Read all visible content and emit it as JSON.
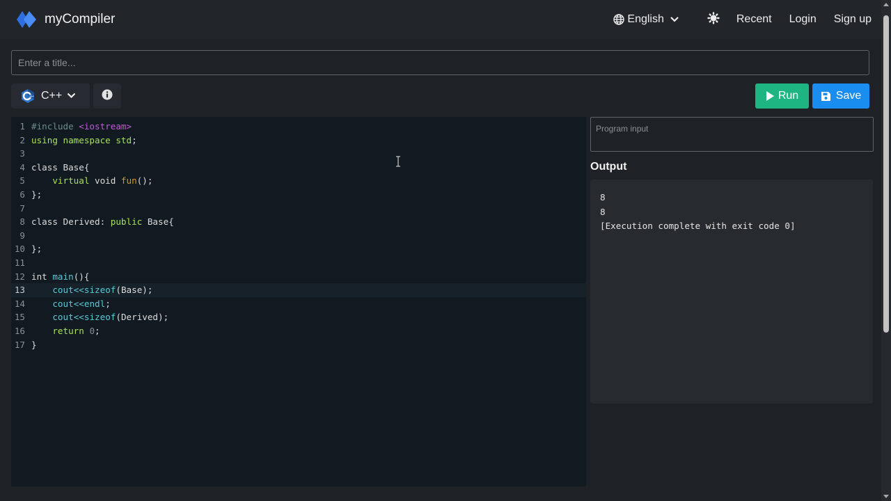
{
  "navbar": {
    "brand": "myCompiler",
    "language": "English",
    "links": [
      "Recent",
      "Login",
      "Sign up"
    ],
    "colors": {
      "brand_logo": "#3b82f6"
    }
  },
  "editor_title": {
    "placeholder": "Enter a title..."
  },
  "toolbar": {
    "language": "C++",
    "run_label": "Run",
    "save_label": "Save",
    "colors": {
      "run": "#1fb583",
      "save": "#1a8ef0"
    }
  },
  "editor": {
    "active_line": 13,
    "lines": [
      [
        [
          "#include ",
          "pre"
        ],
        [
          "<iostream>",
          "inc"
        ]
      ],
      [
        [
          "using namespace std",
          "kw"
        ],
        [
          ";",
          ""
        ]
      ],
      [],
      [
        [
          "class Base{",
          ""
        ]
      ],
      [
        [
          "    ",
          ""
        ],
        [
          "virtual",
          "kw"
        ],
        [
          " void ",
          ""
        ],
        [
          "fun",
          "fn"
        ],
        [
          "();",
          ""
        ]
      ],
      [
        [
          "};",
          ""
        ]
      ],
      [],
      [
        [
          "class Derived: ",
          ""
        ],
        [
          "public",
          "kw"
        ],
        [
          " Base{",
          ""
        ]
      ],
      [],
      [
        [
          "};",
          ""
        ]
      ],
      [],
      [
        [
          "int ",
          ""
        ],
        [
          "main",
          "cout"
        ],
        [
          "(){",
          ""
        ]
      ],
      [
        [
          "    ",
          ""
        ],
        [
          "cout",
          "cout"
        ],
        [
          "<<",
          "tok"
        ],
        [
          "sizeof",
          "cout"
        ],
        [
          "(Base);",
          ""
        ]
      ],
      [
        [
          "    ",
          ""
        ],
        [
          "cout",
          "cout"
        ],
        [
          "<<",
          "tok"
        ],
        [
          "endl",
          "cout"
        ],
        [
          ";",
          ""
        ]
      ],
      [
        [
          "    ",
          ""
        ],
        [
          "cout",
          "cout"
        ],
        [
          "<<",
          "tok"
        ],
        [
          "sizeof",
          "cout"
        ],
        [
          "(Derived);",
          ""
        ]
      ],
      [
        [
          "    ",
          ""
        ],
        [
          "return",
          "kw"
        ],
        [
          " ",
          ""
        ],
        [
          "0",
          "num"
        ],
        [
          ";",
          ""
        ]
      ],
      [
        [
          "}",
          ""
        ]
      ]
    ]
  },
  "io": {
    "input_placeholder": "Program input",
    "output_label": "Output",
    "output_lines": [
      "8",
      "8",
      "[Execution complete with exit code 0]"
    ]
  }
}
